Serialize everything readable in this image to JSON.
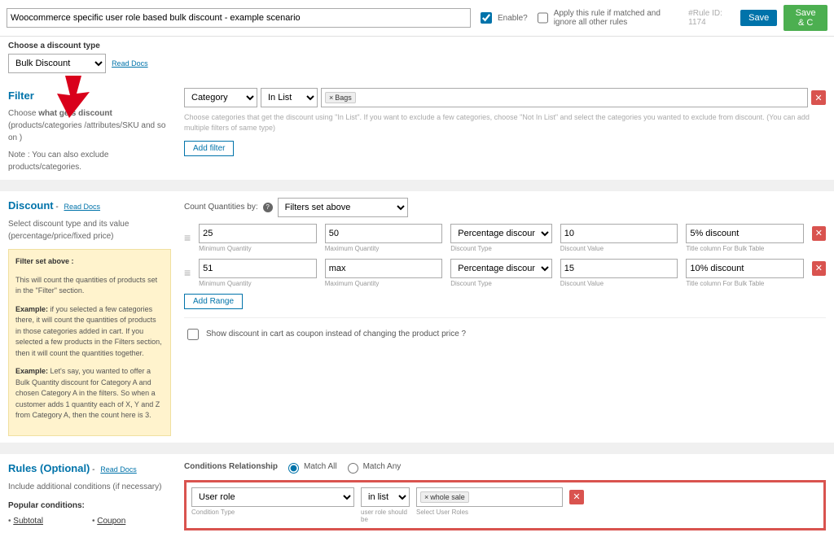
{
  "header": {
    "rule_name": "Woocommerce specific user role based bulk discount - example scenario",
    "enable_label": "Enable?",
    "apply_ignore_label": "Apply this rule if matched and ignore all other rules",
    "rule_id_label": "#Rule ID: 1174",
    "save_label": "Save",
    "save_close_label": "Save & C"
  },
  "discount_type_section": {
    "label": "Choose a discount type",
    "value": "Bulk Discount",
    "read_docs": "Read Docs"
  },
  "filter_section": {
    "title": "Filter",
    "desc1_pre": "Choose ",
    "desc1_bold": "what gets discount ",
    "desc1_post": "(products/categories /attributes/SKU and so on )",
    "desc2": "Note : You can also exclude products/categories.",
    "filter_type": "Category",
    "filter_op": "In List",
    "tag": "Bags",
    "hint": "Choose categories that get the discount using \"In List\". If you want to exclude a few categories, choose \"Not In List\" and select the categories you wanted to exclude from discount. (You can add multiple filters of same type)",
    "add_filter": "Add filter"
  },
  "discount_section": {
    "title": "Discount",
    "read_docs": "Read Docs",
    "desc": "Select discount type and its value (percentage/price/fixed price)",
    "info_title": "Filter set above :",
    "info_p1": "This will count the quantities of products set in the \"Filter\" section.",
    "info_ex1_label": "Example:",
    "info_ex1": " if you selected a few categories there, it will count the quantities of products in those categories added in cart. If you selected a few products in the Filters section, then it will count the quantities together.",
    "info_ex2_label": "Example:",
    "info_ex2": " Let's say, you wanted to offer a Bulk Quantity discount for Category A and chosen Category A in the filters. So when a customer adds 1 quantity each of X, Y and Z from Category A, then the count here is 3.",
    "count_label": "Count Quantities by:",
    "count_value": "Filters set above",
    "ranges": [
      {
        "min": "25",
        "max_v": "50",
        "type": "Percentage discount",
        "val": "10",
        "title": "5% discount"
      },
      {
        "min": "51",
        "max_v": "max",
        "type": "Percentage discount",
        "val": "15",
        "title": "10% discount"
      }
    ],
    "captions": {
      "min": "Minimum Quantity",
      "max": "Maximum Quantity",
      "type": "Discount Type",
      "val": "Discount Value",
      "title": "Title column For Bulk Table"
    },
    "add_range": "Add Range",
    "show_coupon": "Show discount in cart as coupon instead of changing the product price ?"
  },
  "rules_section": {
    "title": "Rules (Optional)",
    "read_docs": "Read Docs",
    "desc": "Include additional conditions (if necessary)",
    "popular_label": "Popular conditions:",
    "popular": [
      "Subtotal",
      "Coupon"
    ],
    "rel_label": "Conditions Relationship",
    "rel_all": "Match All",
    "rel_any": "Match Any",
    "cond_type": "User role",
    "cond_op": "in list",
    "cond_tag": "whole sale",
    "c_type_cap": "Condition Type",
    "c_op_cap": "user role should be",
    "c_val_cap": "Select User Roles"
  }
}
